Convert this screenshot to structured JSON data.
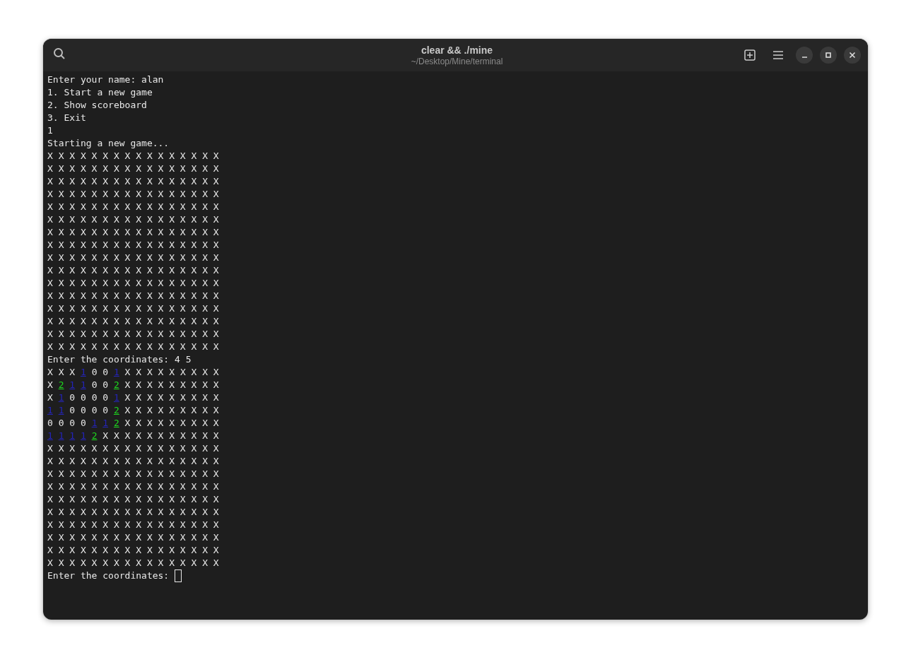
{
  "window": {
    "title": "clear && ./mine",
    "subtitle": "~/Desktop/Mine/terminal"
  },
  "lines": [
    {
      "kind": "text",
      "text": "Enter your name: alan"
    },
    {
      "kind": "text",
      "text": "1. Start a new game"
    },
    {
      "kind": "text",
      "text": "2. Show scoreboard"
    },
    {
      "kind": "text",
      "text": "3. Exit"
    },
    {
      "kind": "text",
      "text": "1"
    },
    {
      "kind": "text",
      "text": "Starting a new game..."
    },
    {
      "kind": "board",
      "text": "X X X X X X X X X X X X X X X X"
    },
    {
      "kind": "board",
      "text": "X X X X X X X X X X X X X X X X"
    },
    {
      "kind": "board",
      "text": "X X X X X X X X X X X X X X X X"
    },
    {
      "kind": "board",
      "text": "X X X X X X X X X X X X X X X X"
    },
    {
      "kind": "board",
      "text": "X X X X X X X X X X X X X X X X"
    },
    {
      "kind": "board",
      "text": "X X X X X X X X X X X X X X X X"
    },
    {
      "kind": "board",
      "text": "X X X X X X X X X X X X X X X X"
    },
    {
      "kind": "board",
      "text": "X X X X X X X X X X X X X X X X"
    },
    {
      "kind": "board",
      "text": "X X X X X X X X X X X X X X X X"
    },
    {
      "kind": "board",
      "text": "X X X X X X X X X X X X X X X X"
    },
    {
      "kind": "board",
      "text": "X X X X X X X X X X X X X X X X"
    },
    {
      "kind": "board",
      "text": "X X X X X X X X X X X X X X X X"
    },
    {
      "kind": "board",
      "text": "X X X X X X X X X X X X X X X X"
    },
    {
      "kind": "board",
      "text": "X X X X X X X X X X X X X X X X"
    },
    {
      "kind": "board",
      "text": "X X X X X X X X X X X X X X X X"
    },
    {
      "kind": "board",
      "text": "X X X X X X X X X X X X X X X X"
    },
    {
      "kind": "text",
      "text": "Enter the coordinates: 4 5"
    },
    {
      "kind": "cells",
      "cells": [
        "X",
        "X",
        "X",
        {
          "text": "1",
          "color": "#2424b8"
        },
        "0",
        "0",
        {
          "text": "1",
          "color": "#2424b8"
        },
        "X",
        "X",
        "X",
        "X",
        "X",
        "X",
        "X",
        "X",
        "X"
      ]
    },
    {
      "kind": "cells",
      "cells": [
        "X",
        {
          "text": "2",
          "color": "#1ed81e"
        },
        {
          "text": "1",
          "color": "#2424b8"
        },
        {
          "text": "1",
          "color": "#2424b8"
        },
        "0",
        "0",
        {
          "text": "2",
          "color": "#1ed81e"
        },
        "X",
        "X",
        "X",
        "X",
        "X",
        "X",
        "X",
        "X",
        "X"
      ]
    },
    {
      "kind": "cells",
      "cells": [
        "X",
        {
          "text": "1",
          "color": "#2424b8"
        },
        "0",
        "0",
        "0",
        "0",
        {
          "text": "1",
          "color": "#2424b8"
        },
        "X",
        "X",
        "X",
        "X",
        "X",
        "X",
        "X",
        "X",
        "X"
      ]
    },
    {
      "kind": "cells",
      "cells": [
        {
          "text": "1",
          "color": "#2424b8"
        },
        {
          "text": "1",
          "color": "#2424b8"
        },
        "0",
        "0",
        "0",
        "0",
        {
          "text": "2",
          "color": "#1ed81e"
        },
        "X",
        "X",
        "X",
        "X",
        "X",
        "X",
        "X",
        "X",
        "X"
      ]
    },
    {
      "kind": "cells",
      "cells": [
        "0",
        "0",
        "0",
        "0",
        {
          "text": "1",
          "color": "#2424b8"
        },
        {
          "text": "1",
          "color": "#2424b8"
        },
        {
          "text": "2",
          "color": "#1ed81e"
        },
        "X",
        "X",
        "X",
        "X",
        "X",
        "X",
        "X",
        "X",
        "X"
      ]
    },
    {
      "kind": "cells",
      "cells": [
        {
          "text": "1",
          "color": "#2424b8"
        },
        {
          "text": "1",
          "color": "#2424b8"
        },
        {
          "text": "1",
          "color": "#2424b8"
        },
        {
          "text": "1",
          "color": "#2424b8"
        },
        {
          "text": "2",
          "color": "#1ed81e"
        },
        "X",
        "X",
        "X",
        "X",
        "X",
        "X",
        "X",
        "X",
        "X",
        "X",
        "X"
      ]
    },
    {
      "kind": "board",
      "text": "X X X X X X X X X X X X X X X X"
    },
    {
      "kind": "board",
      "text": "X X X X X X X X X X X X X X X X"
    },
    {
      "kind": "board",
      "text": "X X X X X X X X X X X X X X X X"
    },
    {
      "kind": "board",
      "text": "X X X X X X X X X X X X X X X X"
    },
    {
      "kind": "board",
      "text": "X X X X X X X X X X X X X X X X"
    },
    {
      "kind": "board",
      "text": "X X X X X X X X X X X X X X X X"
    },
    {
      "kind": "board",
      "text": "X X X X X X X X X X X X X X X X"
    },
    {
      "kind": "board",
      "text": "X X X X X X X X X X X X X X X X"
    },
    {
      "kind": "board",
      "text": "X X X X X X X X X X X X X X X X"
    },
    {
      "kind": "board",
      "text": "X X X X X X X X X X X X X X X X"
    },
    {
      "kind": "prompt",
      "text": "Enter the coordinates: "
    }
  ]
}
